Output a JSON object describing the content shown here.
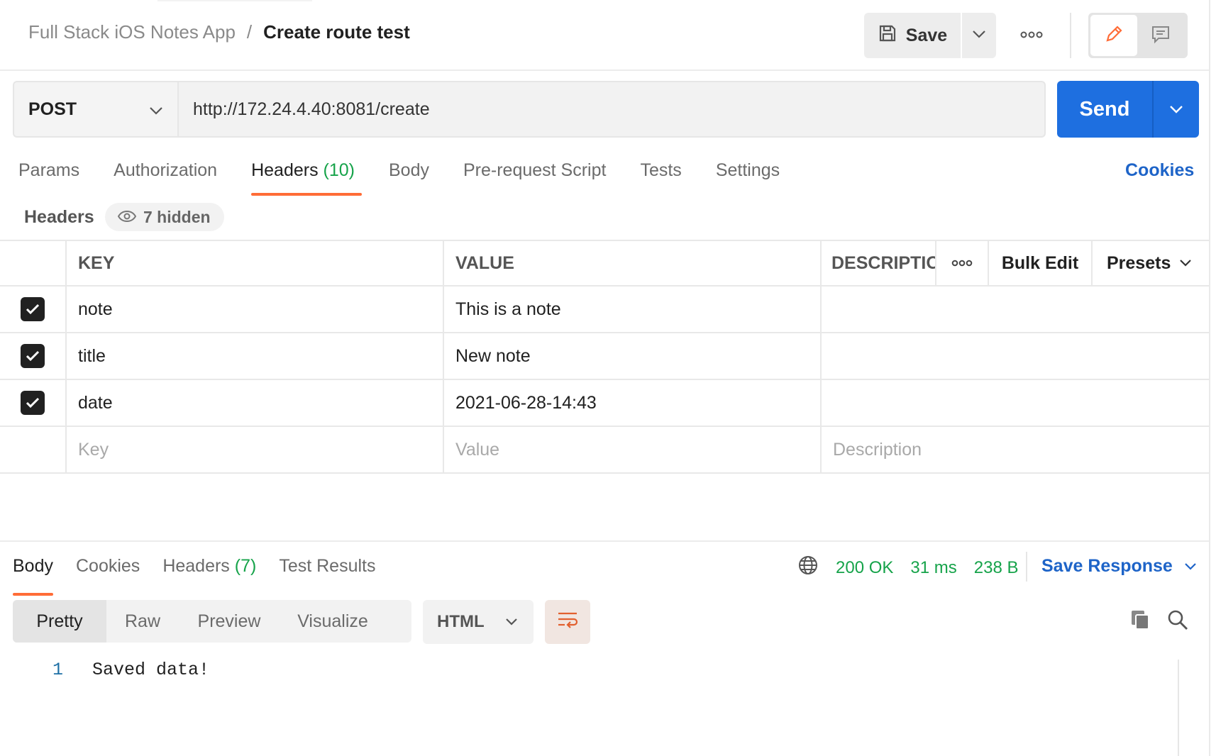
{
  "breadcrumb": {
    "parent": "Full Stack iOS Notes App",
    "separator": "/",
    "current": "Create route test"
  },
  "toolbar": {
    "save_label": "Save"
  },
  "request": {
    "method": "POST",
    "url": "http://172.24.4.40:8081/create",
    "send_label": "Send"
  },
  "request_tabs": {
    "params": "Params",
    "authorization": "Authorization",
    "headers": "Headers",
    "headers_count": "(10)",
    "body": "Body",
    "pre_request": "Pre-request Script",
    "tests": "Tests",
    "settings": "Settings",
    "active": "Headers"
  },
  "cookies_link": "Cookies",
  "headers_section": {
    "label": "Headers",
    "hidden_label": "7 hidden"
  },
  "headers_table": {
    "columns": {
      "key": "KEY",
      "value": "VALUE",
      "description": "DESCRIPTIO",
      "bulk_edit": "Bulk Edit",
      "presets": "Presets"
    },
    "rows": [
      {
        "checked": true,
        "key": "note",
        "value": "This is a note",
        "description": ""
      },
      {
        "checked": true,
        "key": "title",
        "value": "New note",
        "description": ""
      },
      {
        "checked": true,
        "key": "date",
        "value": "2021-06-28-14:43",
        "description": ""
      }
    ],
    "placeholders": {
      "key": "Key",
      "value": "Value",
      "description": "Description"
    }
  },
  "response_tabs": {
    "body": "Body",
    "cookies": "Cookies",
    "headers": "Headers",
    "headers_count": "(7)",
    "test_results": "Test Results",
    "active": "Body"
  },
  "response_status": {
    "status": "200 OK",
    "time": "31 ms",
    "size": "238 B",
    "save_response": "Save Response"
  },
  "response_view": {
    "modes": [
      "Pretty",
      "Raw",
      "Preview",
      "Visualize"
    ],
    "active_mode": "Pretty",
    "format": "HTML"
  },
  "response_body": {
    "line_number": "1",
    "text": "Saved data!"
  },
  "colors": {
    "accent_orange": "#ff6c37",
    "send_blue": "#1e6fe0",
    "link_blue": "#1e64c8",
    "status_green": "#16a34a"
  },
  "icons": [
    "save-icon",
    "chevron-down-icon",
    "more-icon",
    "pencil-icon",
    "comment-icon",
    "eye-icon",
    "checkmark-icon",
    "globe-icon",
    "wrap-lines-icon",
    "copy-icon",
    "search-icon"
  ]
}
